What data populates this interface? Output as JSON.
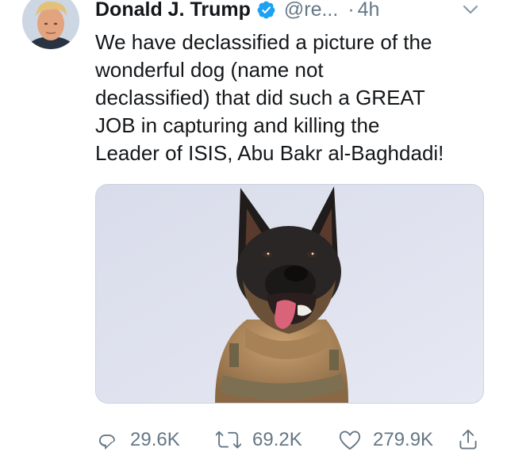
{
  "tweet": {
    "author": {
      "name": "Donald J. Trump",
      "handle": "@re...",
      "verified_icon": "verified-badge-icon",
      "avatar": "profile-avatar"
    },
    "separator": "·",
    "time": "4h",
    "menu_icon": "chevron-down-icon",
    "text_lines": [
      "We have declassified a picture of the",
      "wonderful dog (name not",
      "declassified) that did such a GREAT",
      "JOB in capturing and killing the",
      "Leader of ISIS, Abu Bakr al-Baghdadi!"
    ],
    "media": {
      "kind": "photo",
      "subject": "dog-photo"
    },
    "actions": {
      "reply": {
        "icon": "reply-icon",
        "count": "29.6K"
      },
      "retweet": {
        "icon": "retweet-icon",
        "count": "69.2K"
      },
      "like": {
        "icon": "heart-icon",
        "count": "279.9K"
      },
      "share": {
        "icon": "share-icon"
      }
    },
    "colors": {
      "text": "#14171a",
      "secondary": "#657786",
      "verified": "#1da1f2",
      "border": "#c9d3de"
    }
  }
}
